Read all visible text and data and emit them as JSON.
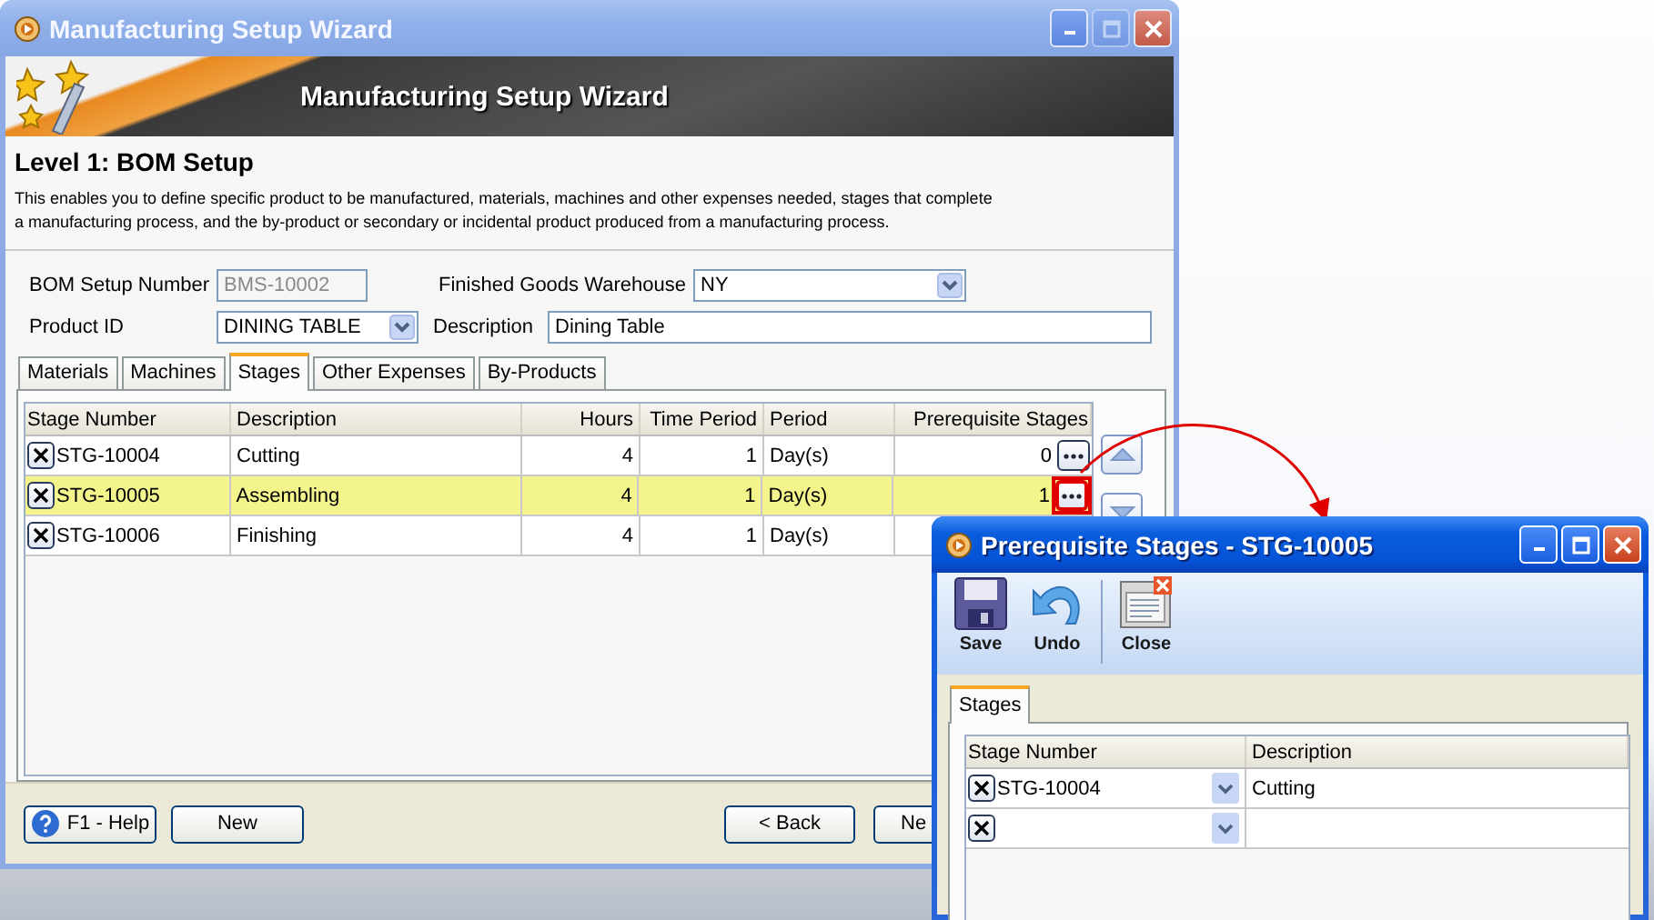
{
  "main_window": {
    "title": "Manufacturing Setup Wizard",
    "banner_title": "Manufacturing Setup Wizard",
    "heading": "Level 1: BOM Setup",
    "intro": "This enables you to define specific product to be manufactured, materials, machines and other expenses needed, stages that complete a manufacturing process, and the by-product or secondary or incidental product produced from a manufacturing process.",
    "form_rows": [
      [
        {
          "label": "BOM Setup Number",
          "value": "BMS-10002",
          "kind": "readonly"
        },
        {
          "label": "Finished Goods Warehouse",
          "value": "NY",
          "kind": "select"
        }
      ],
      [
        {
          "label": "Product ID",
          "value": "DINING TABLE",
          "kind": "select"
        },
        {
          "label": "Description",
          "value": "Dining Table",
          "kind": "text"
        }
      ]
    ],
    "tabs": [
      {
        "label": "Materials",
        "selected": false
      },
      {
        "label": "Machines",
        "selected": false
      },
      {
        "label": "Stages",
        "selected": true
      },
      {
        "label": "Other Expenses",
        "selected": false
      },
      {
        "label": "By-Products",
        "selected": false
      }
    ],
    "grid": {
      "columns": [
        "Stage Number",
        "Description",
        "Hours",
        "Time Period",
        "Period",
        "Prerequisite Stages"
      ],
      "rows": [
        {
          "selected": false,
          "callout": false,
          "cells": [
            "STG-10004",
            "Cutting",
            "4",
            "1",
            "Day(s)",
            "0"
          ]
        },
        {
          "selected": true,
          "callout": true,
          "cells": [
            "STG-10005",
            "Assembling",
            "4",
            "1",
            "Day(s)",
            "1"
          ]
        },
        {
          "selected": false,
          "cells": [
            "STG-10006",
            "Finishing",
            "4",
            "1",
            "Day(s)"
          ]
        }
      ]
    },
    "buttons": [
      {
        "label": "F1 - Help",
        "kind": "help"
      },
      {
        "label": "New",
        "kind": "plain"
      },
      {
        "label": "< Back",
        "kind": "plain"
      },
      {
        "label": "Ne",
        "kind": "plain"
      }
    ]
  },
  "dialog": {
    "title": "Prerequisite Stages - STG-10005",
    "toolbar": [
      {
        "label": "Save",
        "kind": "save"
      },
      {
        "label": "Undo",
        "kind": "undo"
      },
      {
        "kind": "separator"
      },
      {
        "label": "Close",
        "kind": "close"
      }
    ],
    "tabs": [
      {
        "label": "Stages",
        "selected": true
      }
    ],
    "grid": {
      "columns": [
        "Stage Number",
        "Description"
      ],
      "rows": [
        {
          "cells": [
            "STG-10004",
            "Cutting"
          ]
        },
        {
          "cells": []
        }
      ]
    }
  }
}
